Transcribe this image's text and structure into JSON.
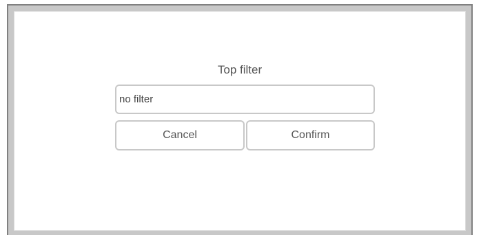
{
  "dialog": {
    "title": "Top filter",
    "input": {
      "value": "no filter",
      "placeholder": ""
    },
    "buttons": {
      "cancel_label": "Cancel",
      "confirm_label": "Confirm"
    }
  },
  "colors": {
    "frame_border": "#808080",
    "frame_fill": "#c8c8c8",
    "control_border": "#c8c8c8",
    "text": "#555555"
  }
}
